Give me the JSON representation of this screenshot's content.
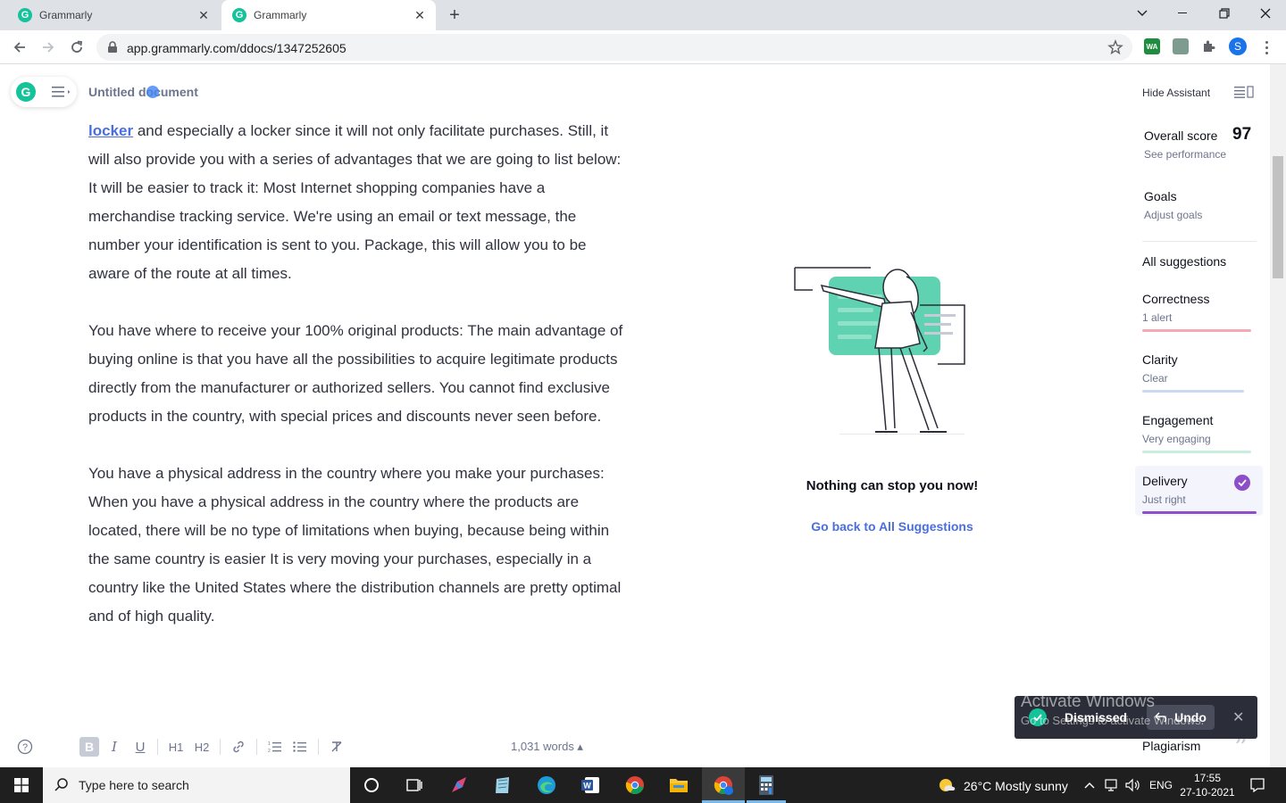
{
  "browser": {
    "tabs": [
      {
        "title": "Grammarly",
        "active": false
      },
      {
        "title": "Grammarly",
        "active": true
      }
    ],
    "url": "app.grammarly.com/ddocs/1347252605",
    "profile_initial": "S",
    "extension_wa_label": "WA"
  },
  "editor": {
    "doc_title": "Untitled document",
    "paragraphs": [
      {
        "link": "locker",
        "text": " and especially a locker since it will not only facilitate purchases. Still, it will also provide you with a series of advantages that we are going to list below:"
      },
      {
        "text": "It will be easier to track it: Most Internet shopping companies have a merchandise tracking service. We're using an email or text message, the number your identification is sent to you. Package, this will allow you to be aware of the route at all times."
      },
      {
        "text": "You have where to receive your 100% original products: The main advantage of buying online is that you have all the possibilities to acquire legitimate products directly from the manufacturer or authorized sellers. You cannot find exclusive products in the country, with special prices and discounts never seen before."
      },
      {
        "text": "You have a physical address in the country where you make your purchases: When you have a physical address in the country where the products are located, there will be no type of limitations when buying, because being within the same country is easier It is very moving your purchases, especially in a country like the United States where the distribution channels are pretty optimal and of high quality."
      }
    ],
    "toolbar": {
      "bold": "B",
      "italic": "I",
      "underline": "U",
      "h1": "H1",
      "h2": "H2",
      "word_count": "1,031 words ▴"
    }
  },
  "assistant": {
    "empty_title": "Nothing can stop you now!",
    "back_link": "Go back to All Suggestions",
    "hide_label": "Hide Assistant",
    "overall_score_label": "Overall score",
    "overall_score_value": "97",
    "see_performance": "See performance",
    "goals_label": "Goals",
    "adjust_goals": "Adjust goals",
    "all_suggestions": "All suggestions",
    "categories": [
      {
        "name": "Correctness",
        "status": "1 alert",
        "color": "#f5a9b8"
      },
      {
        "name": "Clarity",
        "status": "Clear",
        "color": "#c9dcef"
      },
      {
        "name": "Engagement",
        "status": "Very engaging",
        "color": "#c8eedd"
      },
      {
        "name": "Delivery",
        "status": "Just right",
        "color": "#8c4fc7"
      }
    ],
    "plagiarism": "Plagiarism"
  },
  "toast": {
    "message": "Dismissed",
    "undo": "Undo"
  },
  "watermark": {
    "line1": "Activate Windows",
    "line2": "Go to Settings to activate Windows."
  },
  "taskbar": {
    "search_placeholder": "Type here to search",
    "weather": "26°C  Mostly sunny",
    "language": "ENG",
    "time": "17:55",
    "date": "27-10-2021"
  },
  "colors": {
    "grammarly_green": "#15c39a",
    "link_blue": "#4a6ee0",
    "delivery_purple": "#8c4fc7"
  }
}
